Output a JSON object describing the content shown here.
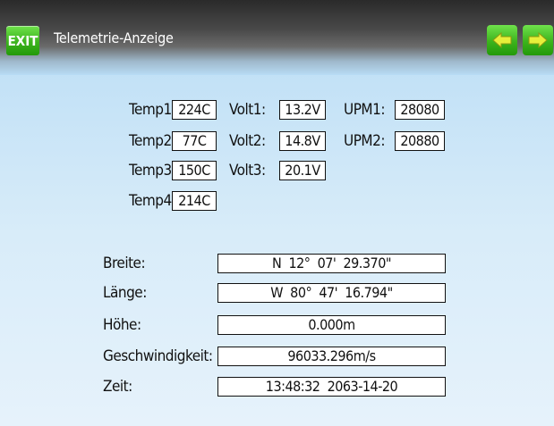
{
  "header": {
    "exit_label": "EXIT",
    "title": "Telemetrie-Anzeige",
    "accent_color": "#3cb31d"
  },
  "telemetry": {
    "temp": [
      {
        "label": "Temp1:",
        "value": "224C"
      },
      {
        "label": "Temp2:",
        "value": "77C"
      },
      {
        "label": "Temp3:",
        "value": "150C"
      },
      {
        "label": "Temp4:",
        "value": "214C"
      }
    ],
    "volt": [
      {
        "label": "Volt1:",
        "value": "13.2V"
      },
      {
        "label": "Volt2:",
        "value": "14.8V"
      },
      {
        "label": "Volt3:",
        "value": "20.1V"
      }
    ],
    "rpm": [
      {
        "label": "UPM1:",
        "value": "28080"
      },
      {
        "label": "UPM2:",
        "value": "20880"
      }
    ]
  },
  "gps": {
    "latitude": {
      "label": "Breite:",
      "value": "N  12°  07'  29.370\""
    },
    "longitude": {
      "label": "Länge:",
      "value": "W  80°  47'  16.794\""
    },
    "altitude": {
      "label": "Höhe:",
      "value": "0.000m"
    },
    "speed": {
      "label": "Geschwindigkeit:",
      "value": "96033.296m/s"
    },
    "time": {
      "label": "Zeit:",
      "value": "13:48:32  2063-14-20"
    }
  }
}
